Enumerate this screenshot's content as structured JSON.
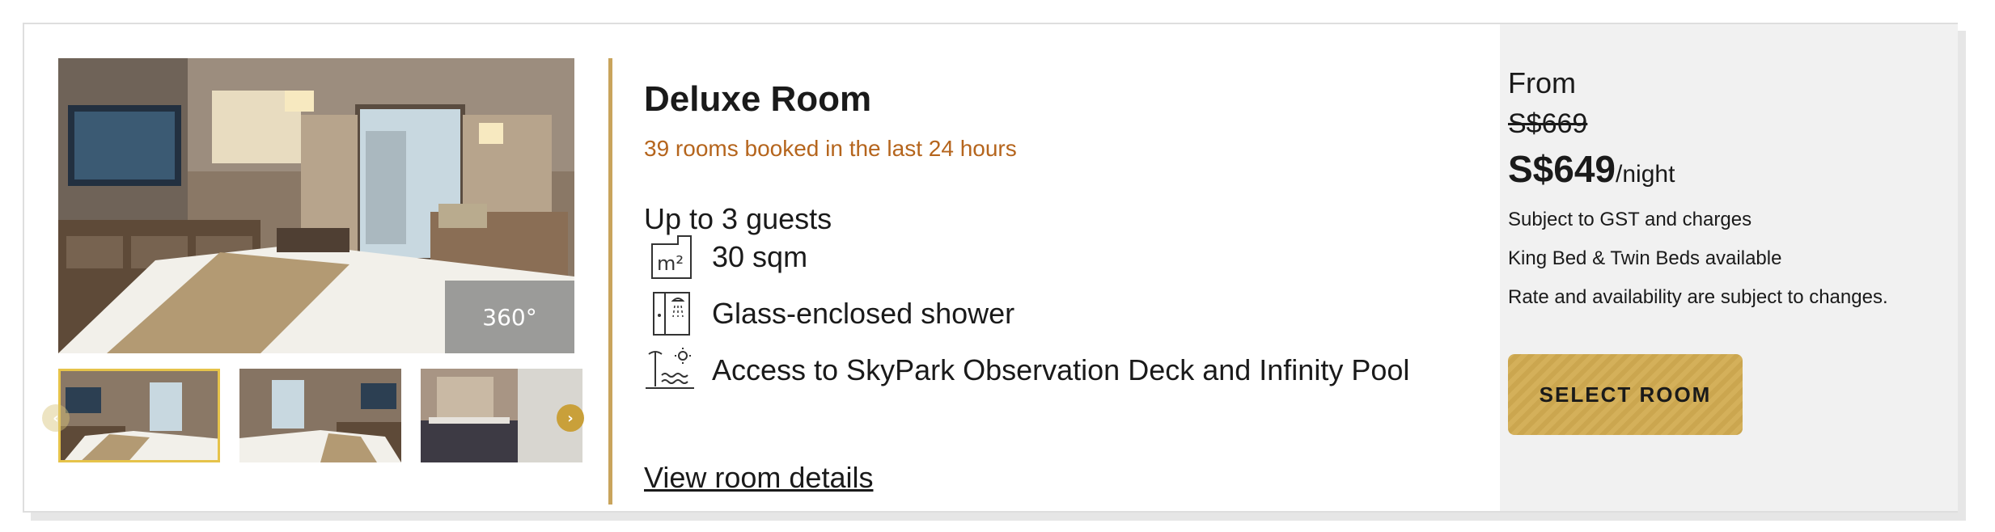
{
  "room": {
    "title": "Deluxe Room",
    "booked_text": "39 rooms booked in the last 24 hours",
    "guests": "Up to 3 guests",
    "features": [
      {
        "icon": "area-m2-icon",
        "text": "30 sqm"
      },
      {
        "icon": "shower-icon",
        "text": "Glass-enclosed shower"
      },
      {
        "icon": "pool-deck-icon",
        "text": "Access to SkyPark Observation Deck and Infinity Pool"
      }
    ],
    "view_details": "View room details"
  },
  "gallery": {
    "badge": "360°",
    "active_thumbnail": 1,
    "thumbnail_count": 3
  },
  "pricing": {
    "from_label": "From",
    "old_price": "S$669",
    "price": "S$649",
    "unit": "/night",
    "notes": [
      "Subject to GST and charges",
      "King Bed & Twin Beds available",
      "Rate and availability are subject to changes."
    ],
    "select_label": "SELECT ROOM"
  },
  "colors": {
    "accent_gold": "#c9a45c",
    "booked_orange": "#b5651d",
    "button_gold": "#d4b05a",
    "panel_grey": "#f1f1f1"
  }
}
